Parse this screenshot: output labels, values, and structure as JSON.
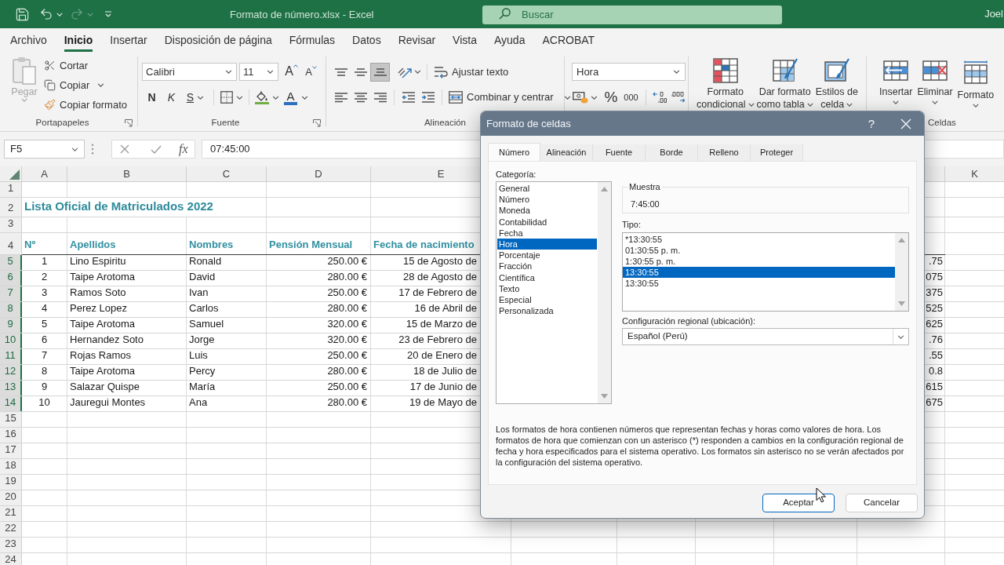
{
  "title_bar": {
    "title": "Formato de número.xlsx - Excel",
    "search": {
      "placeholder": "Buscar"
    },
    "user": "Joel",
    "redo_disabled": true
  },
  "menu_tabs": [
    {
      "label": "Archivo",
      "selected": false
    },
    {
      "label": "Inicio",
      "selected": true
    },
    {
      "label": "Insertar",
      "selected": false
    },
    {
      "label": "Disposición de página",
      "selected": false
    },
    {
      "label": "Fórmulas",
      "selected": false
    },
    {
      "label": "Datos",
      "selected": false
    },
    {
      "label": "Revisar",
      "selected": false
    },
    {
      "label": "Vista",
      "selected": false
    },
    {
      "label": "Ayuda",
      "selected": false
    },
    {
      "label": "ACROBAT",
      "selected": false
    }
  ],
  "ribbon": {
    "clipboard": {
      "label": "Portapapeles",
      "paste": {
        "label": "Pegar",
        "disabled": true
      },
      "cut": "Cortar",
      "copy": "Copiar",
      "format_painter": "Copiar formato"
    },
    "font": {
      "label": "Fuente",
      "font_name": "Calibri",
      "font_size": "11",
      "grow_label": "A",
      "shrink_label": "A",
      "bold_label": "N",
      "italic_label": "K",
      "underline_label": "S",
      "font_color_label": "A"
    },
    "alignment": {
      "label": "Alineación",
      "vertical": [
        {
          "selected": false
        },
        {
          "selected": false
        },
        {
          "selected": true
        }
      ],
      "wrap_text": "Ajustar texto",
      "merge": "Combinar y centrar"
    },
    "number": {
      "format": "Hora",
      "percent_label": "%",
      "comma_label": "000"
    },
    "styles": [
      {
        "kind": "conditional",
        "lines": [
          "Formato",
          "condicional"
        ]
      },
      {
        "kind": "table",
        "lines": [
          "Dar formato",
          "como tabla"
        ]
      },
      {
        "kind": "cellstyles",
        "lines": [
          "Estilos de",
          "celda"
        ]
      }
    ],
    "cells": {
      "label": "Celdas",
      "buttons": [
        {
          "kind": "insert",
          "label": "Insertar"
        },
        {
          "kind": "delete",
          "label": "Eliminar"
        },
        {
          "kind": "format",
          "label": "Formato"
        }
      ]
    }
  },
  "formula_bar": {
    "name_box": "F5",
    "function_label": "fx",
    "value": "07:45:00"
  },
  "sheet": {
    "columns": [
      "A",
      "B",
      "C",
      "D",
      "E"
    ],
    "right_columns": [
      "K"
    ],
    "rows": [
      {
        "number": "1",
        "selected": false,
        "kind": "empty"
      },
      {
        "number": "2",
        "selected": false,
        "kind": "title",
        "text": "Lista Oficial de Matriculados 2022"
      },
      {
        "number": "3",
        "selected": false,
        "kind": "empty"
      },
      {
        "number": "4",
        "selected": false,
        "kind": "header",
        "cells": [
          "Nº",
          "Apellidos",
          "Nombres",
          "Pensión Mensual",
          "Fecha de nacimiento"
        ]
      },
      {
        "number": "5",
        "selected": true,
        "kind": "data",
        "cells": [
          "1",
          "Lino Espiritu",
          "Ronald",
          "250.00 €",
          "15 de Agosto de"
        ],
        "column_j": ".75"
      },
      {
        "number": "6",
        "selected": true,
        "kind": "data",
        "cells": [
          "2",
          "Taipe Arotoma",
          "David",
          "280.00 €",
          "28 de Agosto de"
        ],
        "column_j": "075"
      },
      {
        "number": "7",
        "selected": true,
        "kind": "data",
        "cells": [
          "3",
          "Ramos Soto",
          "Ivan",
          "250.00 €",
          "17 de Febrero de"
        ],
        "column_j": "375"
      },
      {
        "number": "8",
        "selected": true,
        "kind": "data",
        "cells": [
          "4",
          "Perez Lopez",
          "Carlos",
          "280.00 €",
          "16 de Abril de"
        ],
        "column_j": "525"
      },
      {
        "number": "9",
        "selected": true,
        "kind": "data",
        "cells": [
          "5",
          "Taipe Arotoma",
          "Samuel",
          "320.00 €",
          "15 de Marzo de"
        ],
        "column_j": "625"
      },
      {
        "number": "10",
        "selected": true,
        "kind": "data",
        "cells": [
          "6",
          "Hernandez Soto",
          "Jorge",
          "320.00 €",
          "23 de Febrero de"
        ],
        "column_j": ".76"
      },
      {
        "number": "11",
        "selected": true,
        "kind": "data",
        "cells": [
          "7",
          "Rojas Ramos",
          "Luis",
          "250.00 €",
          "20 de Enero de"
        ],
        "column_j": ".55"
      },
      {
        "number": "12",
        "selected": true,
        "kind": "data",
        "cells": [
          "8",
          "Taipe Arotoma",
          "Percy",
          "280.00 €",
          "18 de Julio de"
        ],
        "column_j": "0.8"
      },
      {
        "number": "13",
        "selected": true,
        "kind": "data",
        "cells": [
          "9",
          "Salazar Quispe",
          "María",
          "250.00 €",
          "17 de Junio de"
        ],
        "column_j": "615"
      },
      {
        "number": "14",
        "selected": true,
        "kind": "data",
        "cells": [
          "10",
          "Jauregui Montes",
          "Ana",
          "280.00 €",
          "19 de Mayo de"
        ],
        "column_j": "675"
      },
      {
        "number": "15",
        "selected": false,
        "kind": "empty"
      },
      {
        "number": "16",
        "selected": false,
        "kind": "empty"
      },
      {
        "number": "17",
        "selected": false,
        "kind": "empty"
      },
      {
        "number": "18",
        "selected": false,
        "kind": "empty"
      },
      {
        "number": "19",
        "selected": false,
        "kind": "empty"
      },
      {
        "number": "20",
        "selected": false,
        "kind": "empty"
      },
      {
        "number": "21",
        "selected": false,
        "kind": "empty"
      },
      {
        "number": "22",
        "selected": false,
        "kind": "empty"
      },
      {
        "number": "23",
        "selected": false,
        "kind": "empty"
      },
      {
        "number": "24",
        "selected": false,
        "kind": "empty"
      }
    ]
  },
  "dialog": {
    "title": "Formato de celdas",
    "help_label": "?",
    "tabs": [
      {
        "label": "Número",
        "selected": true
      },
      {
        "label": "Alineación",
        "selected": false
      },
      {
        "label": "Fuente",
        "selected": false
      },
      {
        "label": "Borde",
        "selected": false
      },
      {
        "label": "Relleno",
        "selected": false
      },
      {
        "label": "Proteger",
        "selected": false
      }
    ],
    "category_label": "Categoría:",
    "categories": [
      {
        "label": "General",
        "selected": false
      },
      {
        "label": "Número",
        "selected": false
      },
      {
        "label": "Moneda",
        "selected": false
      },
      {
        "label": "Contabilidad",
        "selected": false
      },
      {
        "label": "Fecha",
        "selected": false
      },
      {
        "label": "Hora",
        "selected": true
      },
      {
        "label": "Porcentaje",
        "selected": false
      },
      {
        "label": "Fracción",
        "selected": false
      },
      {
        "label": "Científica",
        "selected": false
      },
      {
        "label": "Texto",
        "selected": false
      },
      {
        "label": "Especial",
        "selected": false
      },
      {
        "label": "Personalizada",
        "selected": false
      }
    ],
    "sample": {
      "label": "Muestra",
      "value": "7:45:00"
    },
    "type_label": "Tipo:",
    "types": [
      {
        "label": "*13:30:55",
        "selected": false
      },
      {
        "label": "01:30:55 p. m.",
        "selected": false
      },
      {
        "label": "1:30:55 p. m.",
        "selected": false
      },
      {
        "label": "13:30:55",
        "selected": true
      },
      {
        "label": "13:30:55",
        "selected": false
      }
    ],
    "locale": {
      "label": "Configuración regional (ubicación):",
      "value": "Español (Perú)"
    },
    "description": "Los formatos de hora contienen números que representan fechas y horas como valores de hora. Los formatos de hora que comienzan con un asterisco (*) responden a cambios en la configuración regional de fecha y hora especificados para el sistema operativo. Los formatos sin asterisco no se verán afectados por la configuración del sistema operativo.",
    "buttons": [
      {
        "label": "Aceptar",
        "default": true
      },
      {
        "label": "Cancelar",
        "default": false
      }
    ]
  }
}
